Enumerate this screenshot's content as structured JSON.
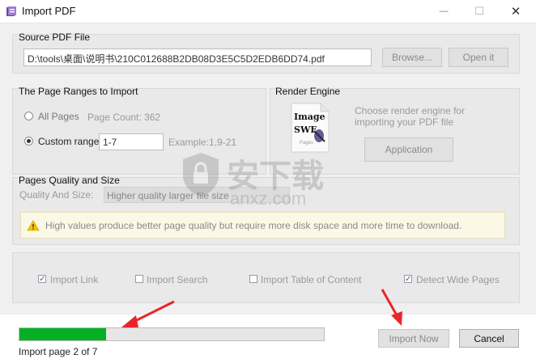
{
  "window": {
    "title": "Import PDF",
    "minimize": "—",
    "maximize": "☐",
    "close": "✕"
  },
  "source": {
    "title": "Source PDF File",
    "path": "D:\\tools\\桌面\\说明书\\210C012688B2DB08D3E5C5D2EDB6DD74.pdf",
    "browse": "Browse...",
    "open": "Open it"
  },
  "ranges": {
    "title": "The Page Ranges to Import",
    "all_pages": "All Pages",
    "page_count": "Page Count: 362",
    "custom_range": "Custom range:",
    "custom_value": "1-7",
    "example": "Example:1,9-21"
  },
  "render": {
    "title": "Render Engine",
    "icon_line1": "Image",
    "icon_line2": "SWF",
    "icon_line3": "Pages",
    "description": "Choose render engine for importing your PDF file",
    "button": "Application"
  },
  "quality": {
    "title": "Pages Quality and Size",
    "label": "Quality And Size:",
    "selected": "Higher quality larger file size",
    "warning": "High values produce better page quality but require more disk space and more time to download."
  },
  "options": {
    "import_link": {
      "label": "Import Link",
      "checked": true
    },
    "import_search": {
      "label": "Import Search",
      "checked": false
    },
    "import_toc": {
      "label": "Import Table of Content",
      "checked": false
    },
    "detect_wide": {
      "label": "Detect Wide Pages",
      "checked": true
    }
  },
  "progress": {
    "fraction": 0.2857,
    "status": "Import page 2 of 7",
    "color": "#06b025"
  },
  "footer": {
    "import_now": "Import Now",
    "cancel": "Cancel"
  },
  "watermark": {
    "big": "安下载",
    "small": "anxz.com"
  },
  "colors": {
    "accent_red": "#e8262a",
    "warning_bg": "#fbf8e6"
  }
}
